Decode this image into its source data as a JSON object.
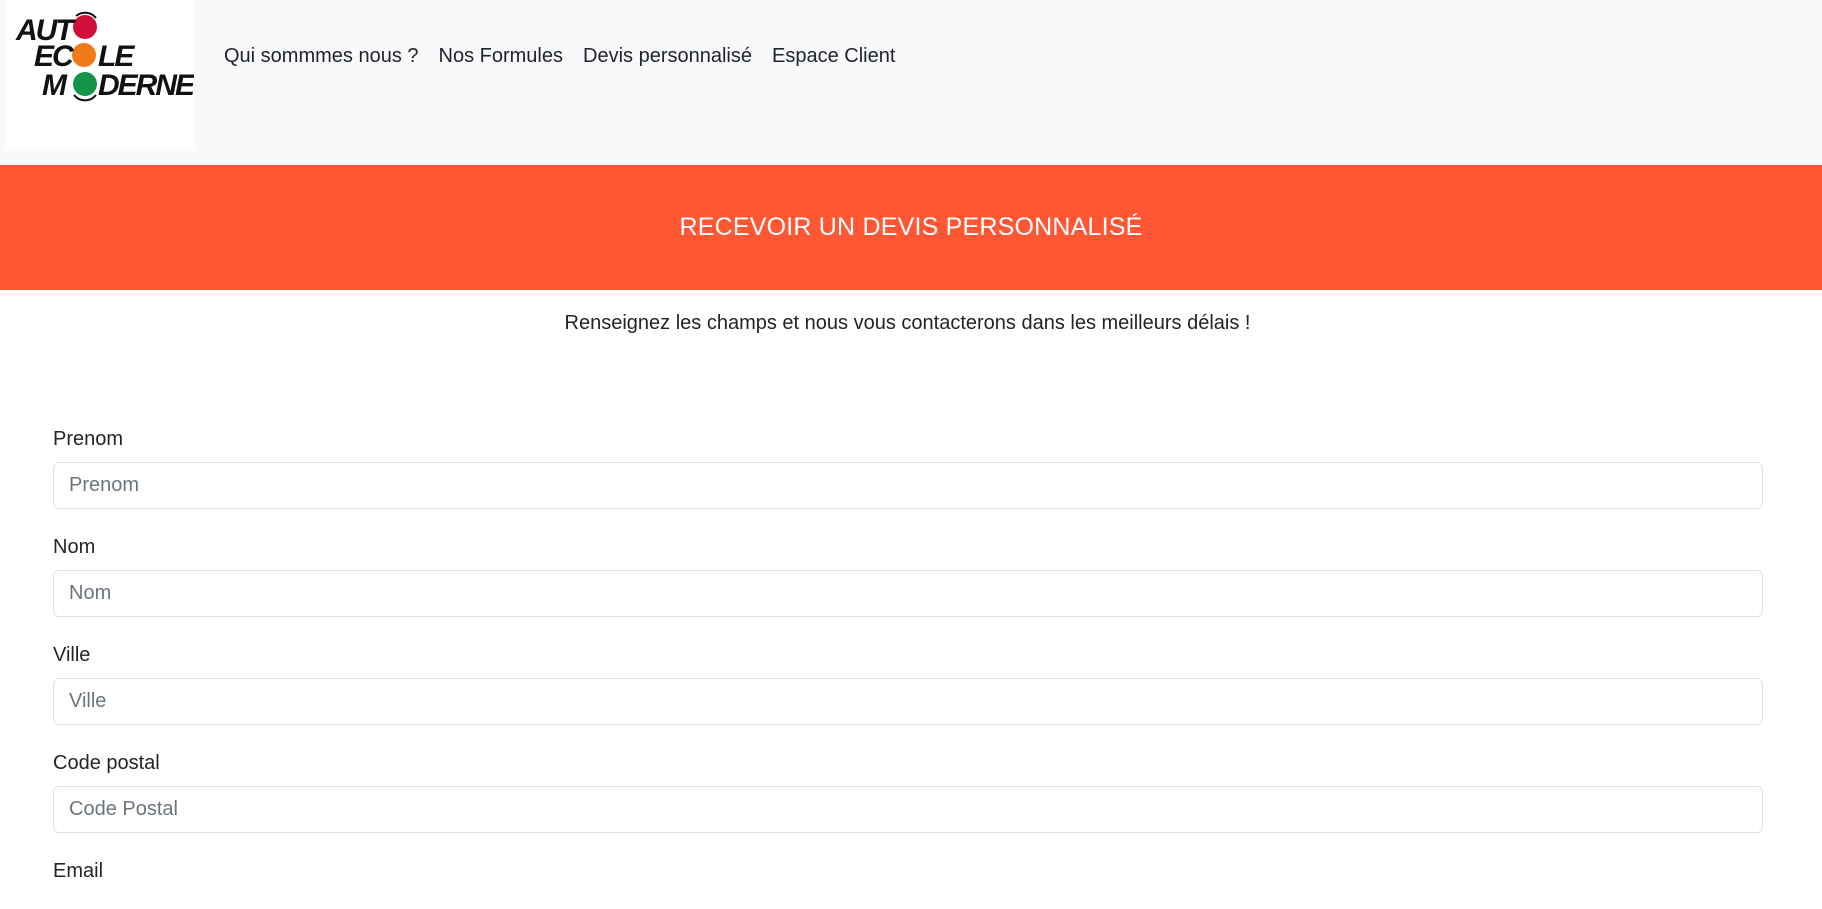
{
  "logo": {
    "line1": "AUTO",
    "line2": "ECOLE",
    "line3": "MODERNE",
    "colors": {
      "red": "#d0103a",
      "orange": "#f07a1a",
      "green": "#14944a"
    }
  },
  "nav": {
    "items": [
      {
        "label": "Qui sommmes nous ?"
      },
      {
        "label": "Nos Formules"
      },
      {
        "label": "Devis personnalisé"
      },
      {
        "label": "Espace Client"
      }
    ]
  },
  "banner": {
    "title": "RECEVOIR UN DEVIS PERSONNALISÉ",
    "color": "#ff5733"
  },
  "intro": {
    "text": "Renseignez les champs et nous vous contacterons dans les meilleurs délais !"
  },
  "form": {
    "fields": [
      {
        "label": "Prenom",
        "placeholder": "Prenom",
        "value": ""
      },
      {
        "label": "Nom",
        "placeholder": "Nom",
        "value": ""
      },
      {
        "label": "Ville",
        "placeholder": "Ville",
        "value": ""
      },
      {
        "label": "Code postal",
        "placeholder": "Code Postal",
        "value": ""
      },
      {
        "label": "Email"
      }
    ]
  }
}
